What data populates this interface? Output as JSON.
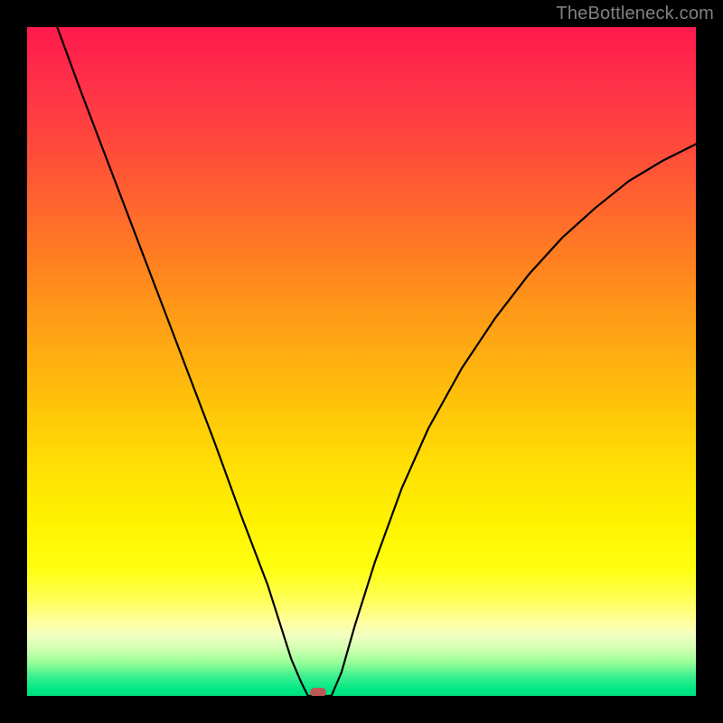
{
  "watermark": "TheBottleneck.com",
  "chart_data": {
    "type": "line",
    "title": "",
    "xlabel": "",
    "ylabel": "",
    "xlim": [
      0,
      1
    ],
    "ylim": [
      0,
      1
    ],
    "background_gradient_top_color": "#ff1a4d",
    "background_gradient_mid_color": "#fff200",
    "background_gradient_bottom_color": "#00e080",
    "series": [
      {
        "name": "curve",
        "x": [
          0.045,
          0.08,
          0.12,
          0.16,
          0.2,
          0.24,
          0.28,
          0.32,
          0.36,
          0.395,
          0.41,
          0.42,
          0.43,
          0.44,
          0.445,
          0.455,
          0.47,
          0.49,
          0.52,
          0.56,
          0.6,
          0.65,
          0.7,
          0.75,
          0.8,
          0.85,
          0.9,
          0.95,
          1.0
        ],
        "y": [
          1.0,
          0.905,
          0.8,
          0.695,
          0.59,
          0.485,
          0.38,
          0.27,
          0.165,
          0.055,
          0.02,
          0.0,
          0.0,
          0.0,
          0.0,
          0.0,
          0.035,
          0.105,
          0.2,
          0.31,
          0.4,
          0.49,
          0.565,
          0.63,
          0.685,
          0.73,
          0.77,
          0.8,
          0.825
        ]
      }
    ],
    "marker": {
      "x": 0.435,
      "y": 0.0,
      "color": "#bb5a55"
    }
  }
}
